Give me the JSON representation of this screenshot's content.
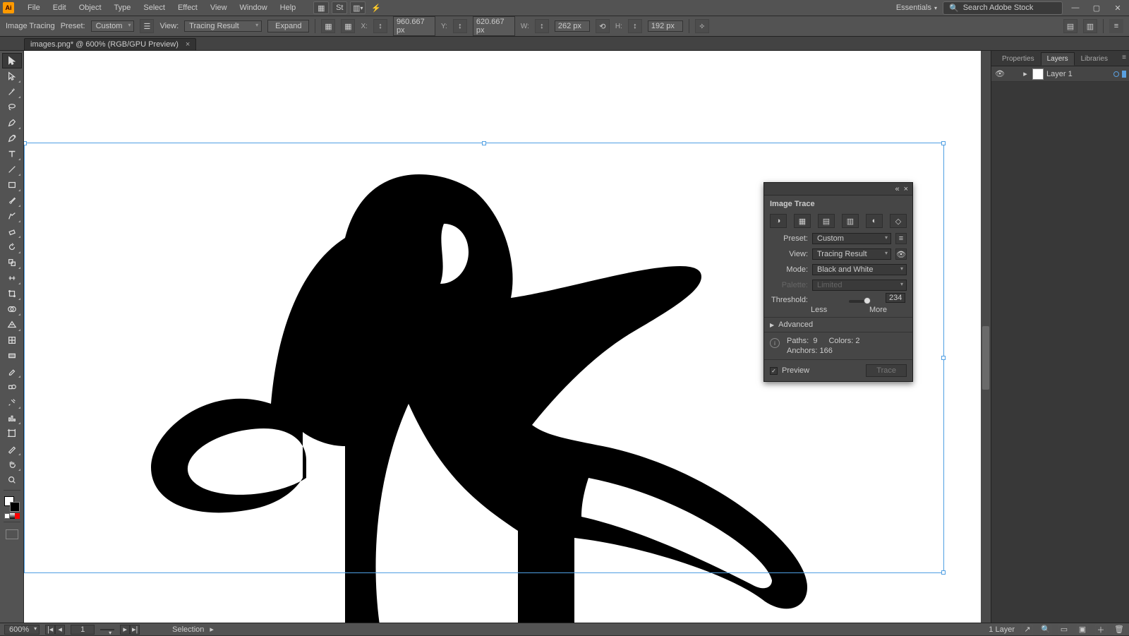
{
  "menubar": {
    "logo": "Ai",
    "items": [
      "File",
      "Edit",
      "Object",
      "Type",
      "Select",
      "Effect",
      "View",
      "Window",
      "Help"
    ],
    "workspace": "Essentials",
    "search_placeholder": "Search Adobe Stock"
  },
  "optbar": {
    "label": "Image Tracing",
    "preset_lbl": "Preset:",
    "preset_val": "Custom",
    "view_lbl": "View:",
    "view_val": "Tracing Result",
    "expand": "Expand",
    "x_lbl": "X:",
    "x_val": "960.667 px",
    "y_lbl": "Y:",
    "y_val": "620.667 px",
    "w_lbl": "W:",
    "w_val": "262 px",
    "h_lbl": "H:",
    "h_val": "192 px"
  },
  "doc": {
    "tab": "images.png* @ 600% (RGB/GPU Preview)"
  },
  "imageTrace": {
    "title": "Image Trace",
    "preset_lbl": "Preset:",
    "preset_val": "Custom",
    "view_lbl": "View:",
    "view_val": "Tracing Result",
    "mode_lbl": "Mode:",
    "mode_val": "Black and White",
    "palette_lbl": "Palette:",
    "palette_val": "Limited",
    "threshold_lbl": "Threshold:",
    "threshold_val": "234",
    "less": "Less",
    "more": "More",
    "advanced": "Advanced",
    "paths_lbl": "Paths:",
    "paths_val": "9",
    "colors_lbl": "Colors:",
    "colors_val": "2",
    "anchors_lbl": "Anchors:",
    "anchors_val": "166",
    "preview": "Preview",
    "trace": "Trace"
  },
  "rightPanels": {
    "tabs": [
      "Properties",
      "Layers",
      "Libraries"
    ],
    "active": 1,
    "layer_name": "Layer 1"
  },
  "status": {
    "zoom": "600%",
    "artboard": "1",
    "tool": "Selection",
    "layers_count": "1 Layer"
  }
}
